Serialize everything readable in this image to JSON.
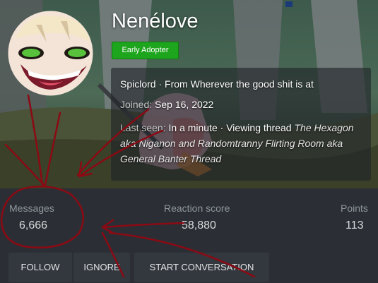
{
  "profile": {
    "username": "Nenélove",
    "badge": "Early Adopter",
    "custom_title": "Spiclord",
    "location": "From Wherever the good shit is at",
    "joined_label": "Joined:",
    "joined_date": "Sep 16, 2022",
    "last_seen_label": "Last seen:",
    "last_seen_when": "In a minute",
    "last_seen_activity": "Viewing thread",
    "last_seen_thread": "The Hexagon aka Niganon and Randomtranny Flirting Room aka General Banter Thread"
  },
  "stats": {
    "messages_label": "Messages",
    "messages_value": "6,666",
    "reaction_label": "Reaction score",
    "reaction_value": "58,880",
    "points_label": "Points",
    "points_value": "113"
  },
  "actions": {
    "follow": "FOLLOW",
    "ignore": "IGNORE",
    "start_conversation": "START CONVERSATION"
  },
  "colors": {
    "badge_bg": "#1ea51e",
    "annotation_red": "#8b0a14",
    "page_bg": "#24282d"
  }
}
